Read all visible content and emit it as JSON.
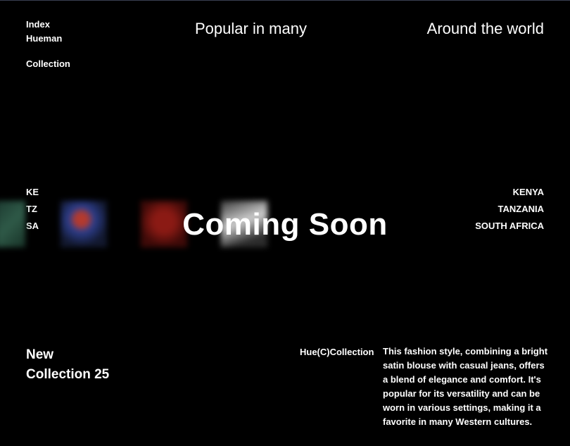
{
  "nav": {
    "items": [
      "Index",
      "Hueman",
      "Collection"
    ]
  },
  "header": {
    "tagline_middle": "Popular in many",
    "tagline_right": "Around the world"
  },
  "hero": {
    "title": "Coming Soon"
  },
  "country_codes": [
    "KE",
    "TZ",
    "SA"
  ],
  "countries": [
    "KENYA",
    "TANZANIA",
    "SOUTH AFRICA"
  ],
  "gallery": {
    "images": [
      "outfit-photo-green",
      "outfit-photo-blue-red",
      "outfit-photo-red",
      "outfit-photo-white"
    ]
  },
  "footer": {
    "new_collection_line1": "New",
    "new_collection_line2": "Collection 25",
    "brand": "Hue(C)Collection",
    "description": "This fashion style, combining a bright satin blouse with casual jeans, offers a blend of elegance and comfort. It's popular for its versatility and can be worn in various settings, making it a favorite in many Western cultures."
  }
}
